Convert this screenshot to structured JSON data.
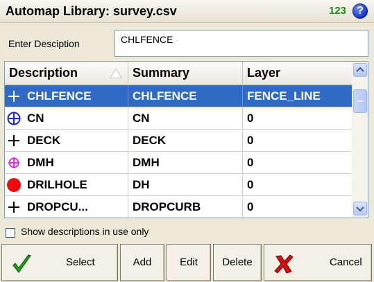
{
  "window": {
    "title": "Automap Library: survey.csv",
    "num_icon": "123",
    "help_icon": "?"
  },
  "filter": {
    "label": "Enter Desciption",
    "value": "CHLFENCE"
  },
  "table": {
    "columns": [
      "Description",
      "Summary",
      "Layer"
    ],
    "sort_column": "Description",
    "rows": [
      {
        "icon": "plus-icon",
        "description": "CHLFENCE",
        "summary": "CHLFENCE",
        "layer": "FENCE_LINE",
        "selected": true
      },
      {
        "icon": "blue-crosshair-circle-icon",
        "description": "CN",
        "summary": "CN",
        "layer": "0",
        "selected": false
      },
      {
        "icon": "plus-icon",
        "description": "DECK",
        "summary": "DECK",
        "layer": "0",
        "selected": false
      },
      {
        "icon": "magenta-crosshair-circle-icon",
        "description": "DMH",
        "summary": "DMH",
        "layer": "0",
        "selected": false
      },
      {
        "icon": "red-filled-circle-icon",
        "description": "DRILHOLE",
        "summary": "DH",
        "layer": "0",
        "selected": false
      },
      {
        "icon": "plus-icon",
        "description": "DROPCU...",
        "summary": "DROPCURB",
        "layer": "0",
        "selected": false
      }
    ]
  },
  "show_in_use": {
    "label": "Show descriptions in use only",
    "checked": false
  },
  "buttons": {
    "select": "Select",
    "add": "Add",
    "edit": "Edit",
    "delete": "Delete",
    "cancel": "Cancel"
  },
  "colors": {
    "selection": "#316ac5",
    "check_green": "#21a321",
    "cancel_red": "#d01010"
  }
}
